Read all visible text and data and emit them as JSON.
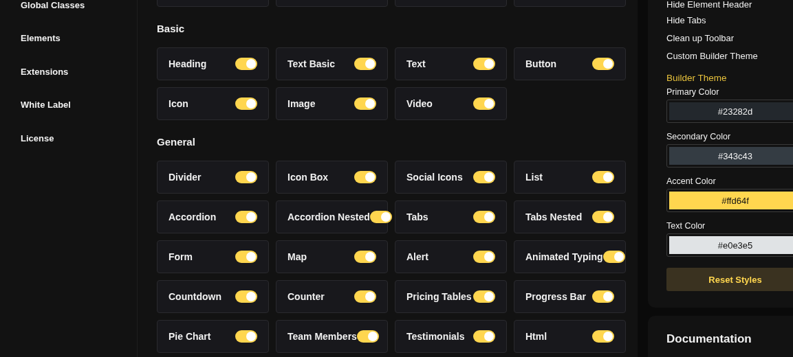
{
  "sidebar": {
    "items": [
      {
        "label": "Global Classes",
        "selected": false
      },
      {
        "label": "Elements",
        "selected": false
      },
      {
        "label": "Extensions",
        "selected": false
      },
      {
        "label": "White Label",
        "selected": false
      },
      {
        "label": "License",
        "selected": false
      }
    ]
  },
  "sections": [
    {
      "title": "Basic",
      "items": [
        {
          "label": "Heading",
          "on": true
        },
        {
          "label": "Text Basic",
          "on": true
        },
        {
          "label": "Text",
          "on": true
        },
        {
          "label": "Button",
          "on": true
        },
        {
          "label": "Icon",
          "on": true
        },
        {
          "label": "Image",
          "on": true
        },
        {
          "label": "Video",
          "on": true
        }
      ]
    },
    {
      "title": "General",
      "items": [
        {
          "label": "Divider",
          "on": true
        },
        {
          "label": "Icon Box",
          "on": true
        },
        {
          "label": "Social Icons",
          "on": true
        },
        {
          "label": "List",
          "on": true
        },
        {
          "label": "Accordion",
          "on": true
        },
        {
          "label": "Accordion Nested",
          "on": true
        },
        {
          "label": "Tabs",
          "on": true
        },
        {
          "label": "Tabs Nested",
          "on": true
        },
        {
          "label": "Form",
          "on": true
        },
        {
          "label": "Map",
          "on": true
        },
        {
          "label": "Alert",
          "on": true
        },
        {
          "label": "Animated Typing",
          "on": true
        },
        {
          "label": "Countdown",
          "on": true
        },
        {
          "label": "Counter",
          "on": true
        },
        {
          "label": "Pricing Tables",
          "on": true
        },
        {
          "label": "Progress Bar",
          "on": true
        },
        {
          "label": "Pie Chart",
          "on": true
        },
        {
          "label": "Team Members",
          "on": true
        },
        {
          "label": "Testimonials",
          "on": true
        },
        {
          "label": "Html",
          "on": true
        }
      ]
    }
  ],
  "options_panel": {
    "options": [
      "Hide Element Header",
      "Hide Tabs",
      "Clean up Toolbar",
      "Custom Builder Theme"
    ],
    "theme_title": "Builder Theme",
    "colors": [
      {
        "label": "Primary Color",
        "value": "#23282d",
        "color": "#23282d"
      },
      {
        "label": "Secondary Color",
        "value": "#343c43",
        "color": "#343c43"
      },
      {
        "label": "Accent Color",
        "value": "#ffd64f",
        "color": "#ffd64f"
      },
      {
        "label": "Text Color",
        "value": "#e0e3e5",
        "color": "#e0e3e5"
      }
    ],
    "reset_button": "Reset Styles"
  },
  "documentation": {
    "title": "Documentation"
  }
}
